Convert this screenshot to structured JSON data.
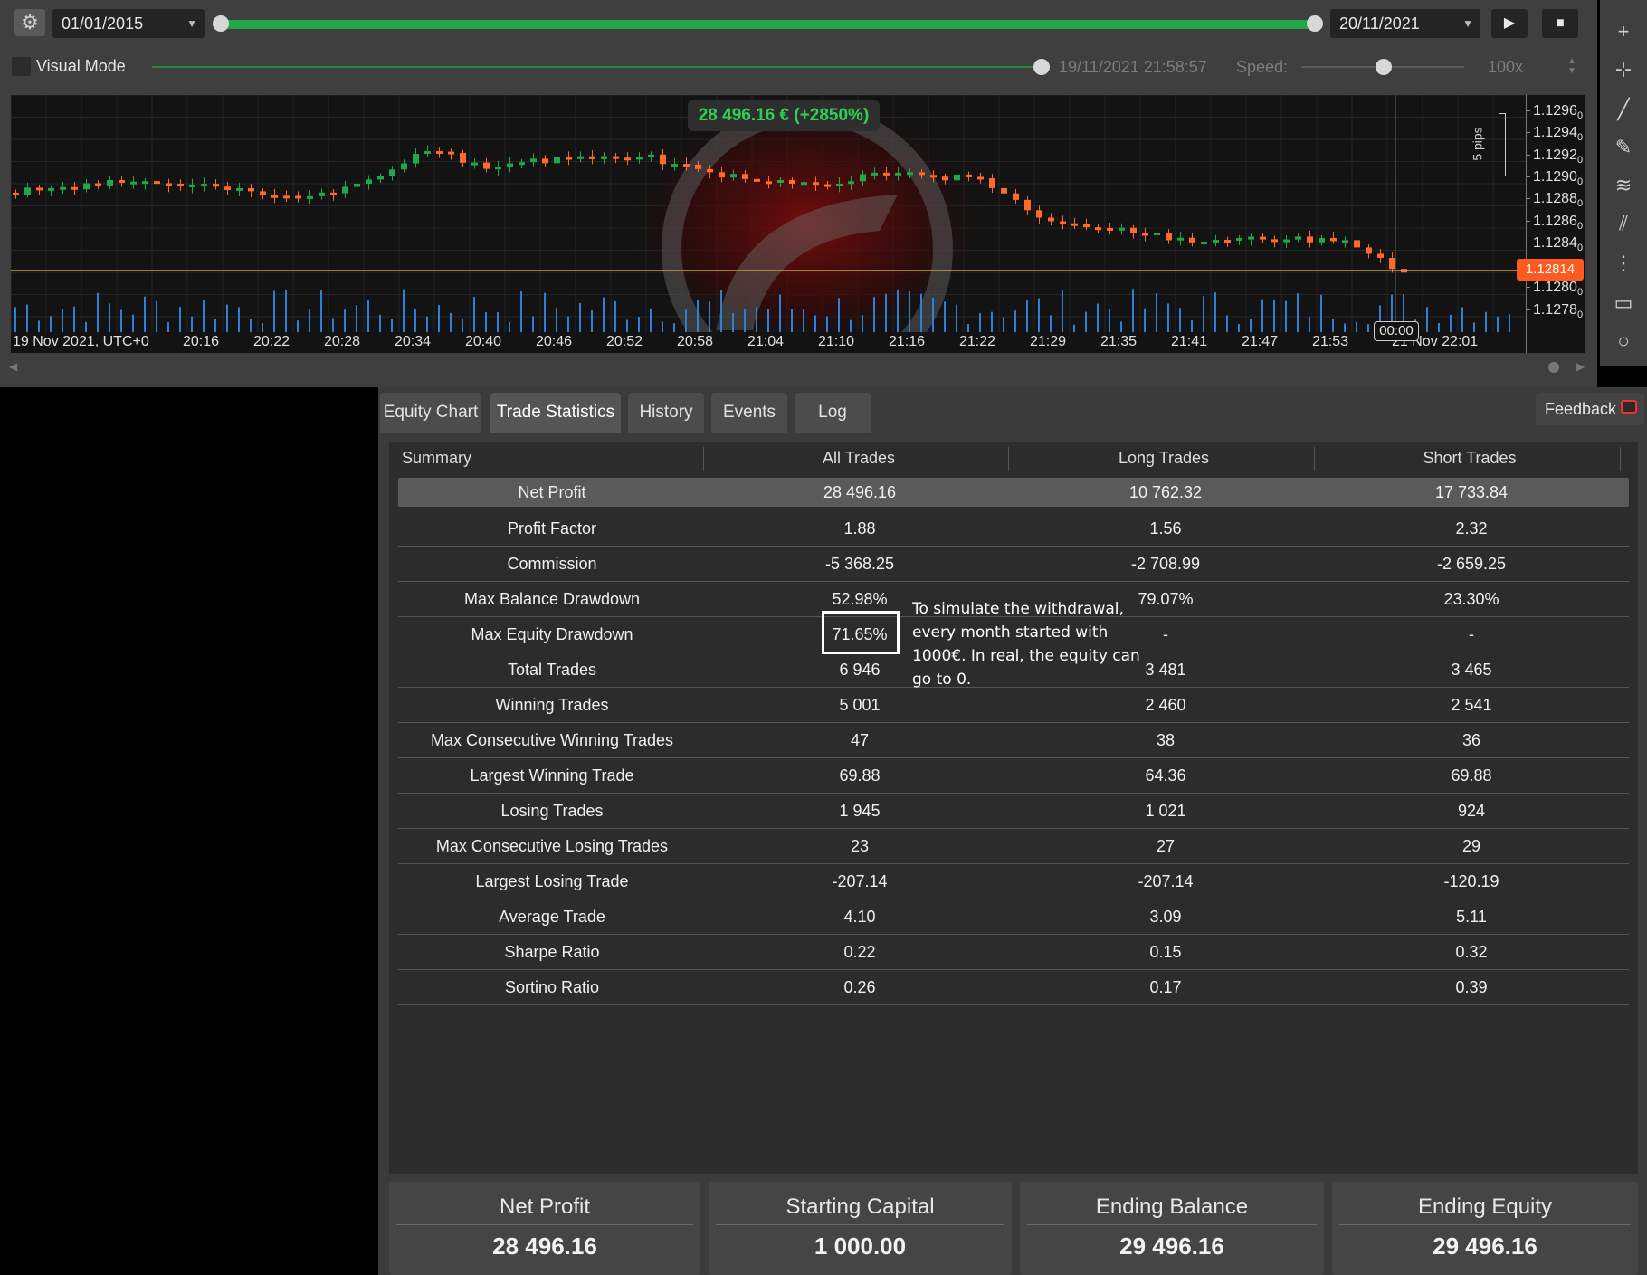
{
  "toolbar": {
    "start_date": "01/01/2015",
    "end_date": "20/11/2021",
    "play_icon": "play-icon",
    "stop_icon": "stop-icon",
    "settings_icon": "gear-icon"
  },
  "visual_mode": {
    "label": "Visual Mode",
    "checked": false,
    "timestamp": "19/11/2021 21:58:57",
    "speed_label": "Speed:",
    "speed_value": "100x"
  },
  "chart": {
    "profit_bubble": "28 496.16 € (+2850%)",
    "pips_label": "5 pips",
    "current_price": "1.12814",
    "cursor_time": "00:00",
    "price_ticks": [
      "1.1296",
      "1.1294",
      "1.1292",
      "1.1290",
      "1.1288",
      "1.1286",
      "1.1284",
      "1.1280",
      "1.1278"
    ],
    "price_tick_subscript": "0",
    "time_ticks": [
      "19 Nov 2021, UTC+0",
      "20:16",
      "20:22",
      "20:28",
      "20:34",
      "20:40",
      "20:46",
      "20:52",
      "20:58",
      "21:04",
      "21:10",
      "21:16",
      "21:22",
      "21:29",
      "21:35",
      "21:41",
      "21:47",
      "21:53",
      "21 Nov 22:01"
    ],
    "colors": {
      "bull": "#1fa84a",
      "bear": "#ff6a2a",
      "price_line": "#c4a24a"
    }
  },
  "right_toolbar": [
    "crosshair-icon",
    "measure-icon",
    "line-icon",
    "pencil-icon",
    "fibonacci-icon",
    "channel-icon",
    "grid-lines-icon",
    "rectangle-icon",
    "ellipse-icon"
  ],
  "tabs": [
    "Equity Chart",
    "Trade Statistics",
    "History",
    "Events",
    "Log"
  ],
  "active_tab": "Trade Statistics",
  "feedback": {
    "label": "Feedback",
    "icon": "chat-bubble-icon"
  },
  "statistics": {
    "headers": [
      "Summary",
      "All Trades",
      "Long Trades",
      "Short Trades"
    ],
    "rows": [
      {
        "label": "Net Profit",
        "all": "28 496.16",
        "long": "10 762.32",
        "short": "17 733.84"
      },
      {
        "label": "Profit Factor",
        "all": "1.88",
        "long": "1.56",
        "short": "2.32"
      },
      {
        "label": "Commission",
        "all": "-5 368.25",
        "long": "-2 708.99",
        "short": "-2 659.25"
      },
      {
        "label": "Max Balance Drawdown",
        "all": "52.98%",
        "long": "79.07%",
        "short": "23.30%"
      },
      {
        "label": "Max Equity Drawdown",
        "all": "71.65%",
        "long": "-",
        "short": "-"
      },
      {
        "label": "Total Trades",
        "all": "6 946",
        "long": "3 481",
        "short": "3 465"
      },
      {
        "label": "Winning Trades",
        "all": "5 001",
        "long": "2 460",
        "short": "2 541"
      },
      {
        "label": "Max Consecutive Winning Trades",
        "all": "47",
        "long": "38",
        "short": "36"
      },
      {
        "label": "Largest Winning Trade",
        "all": "69.88",
        "long": "64.36",
        "short": "69.88"
      },
      {
        "label": "Losing Trades",
        "all": "1 945",
        "long": "1 021",
        "short": "924"
      },
      {
        "label": "Max Consecutive Losing Trades",
        "all": "23",
        "long": "27",
        "short": "29"
      },
      {
        "label": "Largest Losing Trade",
        "all": "-207.14",
        "long": "-207.14",
        "short": "-120.19"
      },
      {
        "label": "Average Trade",
        "all": "4.10",
        "long": "3.09",
        "short": "5.11"
      },
      {
        "label": "Sharpe Ratio",
        "all": "0.22",
        "long": "0.15",
        "short": "0.32"
      },
      {
        "label": "Sortino Ratio",
        "all": "0.26",
        "long": "0.17",
        "short": "0.39"
      }
    ]
  },
  "annotation": "To simulate the withdrawal, every month started with 1000€. In real, the equity can go to 0.",
  "summary_cards": [
    {
      "title": "Net Profit",
      "value": "28 496.16"
    },
    {
      "title": "Starting Capital",
      "value": "1 000.00"
    },
    {
      "title": "Ending Balance",
      "value": "29 496.16"
    },
    {
      "title": "Ending Equity",
      "value": "29 496.16"
    }
  ]
}
